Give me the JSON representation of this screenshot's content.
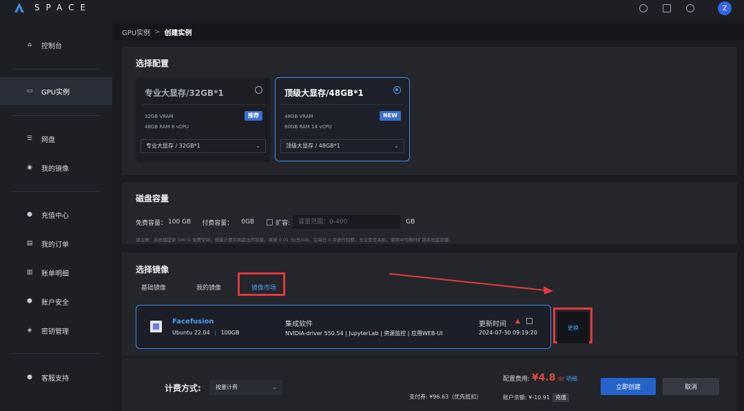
{
  "brand": {
    "name": "SPACE"
  },
  "topbar": {
    "avatar_letter": "Z",
    "icons": [
      "help-icon",
      "notes-icon",
      "message-icon"
    ]
  },
  "sidebar": {
    "items": [
      {
        "label": "控制台",
        "icon": "home-icon"
      },
      {
        "label": "GPU实例",
        "icon": "gpu-icon",
        "active": true
      },
      {
        "label": "网盘",
        "icon": "drive-icon"
      },
      {
        "label": "我的镜像",
        "icon": "image-icon"
      },
      {
        "label": "充值中心",
        "icon": "recharge-icon"
      },
      {
        "label": "我的订单",
        "icon": "orders-icon"
      },
      {
        "label": "账单明细",
        "icon": "bill-icon"
      },
      {
        "label": "账户安全",
        "icon": "security-icon"
      },
      {
        "label": "密钥管理",
        "icon": "key-icon"
      },
      {
        "label": "客服支持",
        "icon": "support-icon"
      }
    ]
  },
  "breadcrumb": {
    "parent": "GPU实例",
    "separator": ">",
    "current": "创建实例"
  },
  "config": {
    "title": "选择配置",
    "cards": [
      {
        "title": "专业大显存/32GB*1",
        "vram": "32GB VRAM",
        "ram": "48GB RAM 8 vCPU",
        "badge": "推荐",
        "select": "专业大显存 / 32GB*1",
        "selected": false
      },
      {
        "title": "顶级大显存/48GB*1",
        "vram": "48GB VRAM",
        "ram": "60GB RAM 14 vCPU",
        "badge": "NEW",
        "select": "顶级大显存 / 48GB*1",
        "selected": true
      }
    ]
  },
  "disk": {
    "title": "磁盘容量",
    "free_label": "免费容量：",
    "free_value": "100 GB",
    "paid_label": "付费容量：",
    "paid_value": "0GB",
    "expand_label": "扩容:",
    "input_placeholder": "容量范围：0-400",
    "unit": "GB",
    "note": "请注意：系统盘提供 100 G 免费空间，按量计费实例超出的容量，将按 0.01 元/日/GB，在每日 0 点进行扣费，无论是否关机，使用中可随时扩容系统盘容量。"
  },
  "image": {
    "title": "选择镜像",
    "tabs": [
      {
        "label": "基础镜像",
        "active": false
      },
      {
        "label": "我的镜像",
        "active": false
      },
      {
        "label": "镜像市场",
        "active": true
      }
    ],
    "card": {
      "name": "Facefusion",
      "os": "Ubuntu 22.04",
      "size": "100GB",
      "software_label": "集成软件",
      "software": "NVIDIA-driver 550.54 | JupyterLab | 资源监控 | 应用WEB-UI",
      "update_label": "更新时间",
      "update_time": "2024-07-30 09:19:20"
    },
    "change_label": "更换"
  },
  "footer": {
    "billing_label": "计费方式:",
    "billing_value": "按量计费",
    "cost_label": "配置费用:",
    "price": "¥4.8",
    "price_unit": "/时",
    "detail_link": "明细",
    "voucher": "支付券: ¥96.63（优先抵扣）",
    "balance": "账户余额: ¥-10.91",
    "recharge": "充值",
    "create_button": "立即创建",
    "cancel_button": "取消"
  },
  "colors": {
    "accent": "#4a9cf5",
    "primary_button": "#2563c9",
    "highlight_red": "#e23a3a",
    "price_red": "#e04a3f"
  }
}
